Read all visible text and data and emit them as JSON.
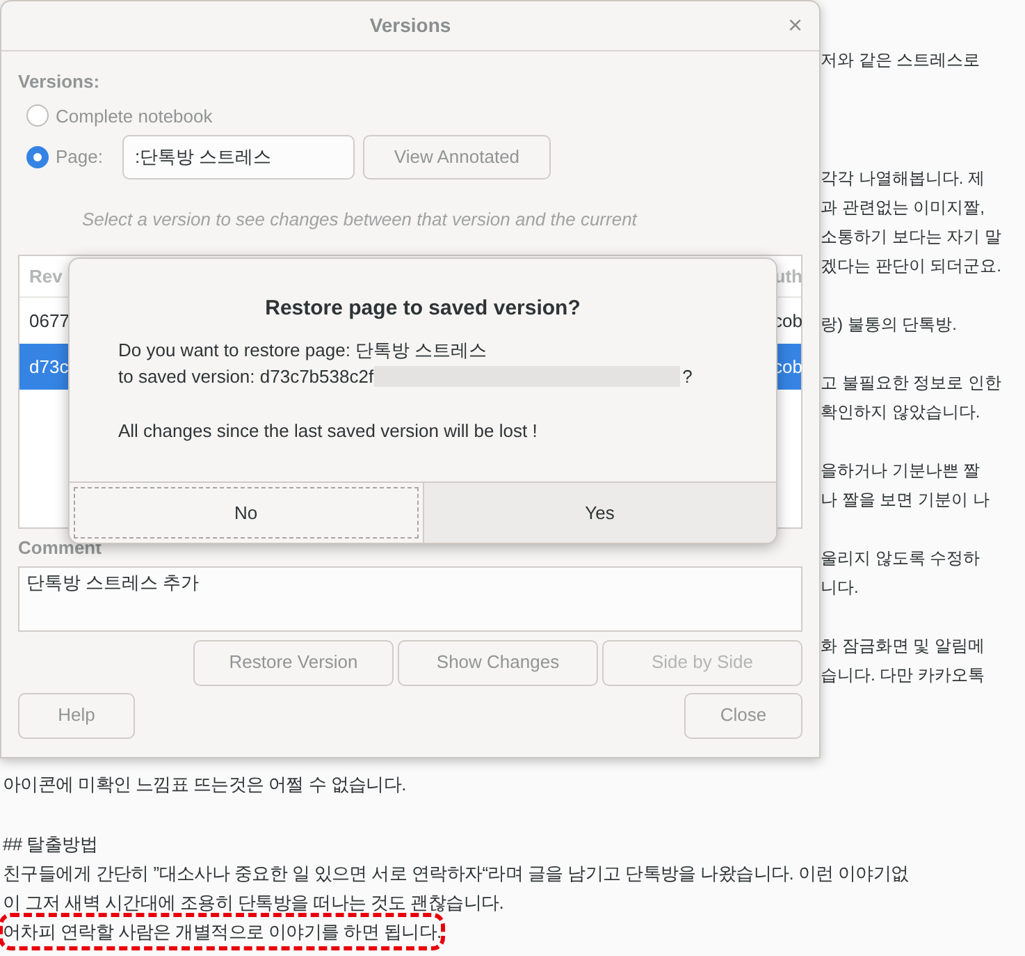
{
  "document": {
    "right_lines": [
      "저와 같은 스트레스로",
      "각각 나열해봅니다. 제",
      "과 관련없는 이미지짤,",
      "소통하기 보다는 자기 말",
      "겠다는 판단이 되더군요.",
      "랑) 불통의 단톡방.",
      "고 불필요한 정보로 인한",
      "확인하지 않았습니다.",
      "을하거나 기분나쁜 짤",
      "나 짤을 보면 기분이 나",
      "울리지 않도록 수정하",
      "니다.",
      "화 잠금화면 및 알림메",
      "습니다. 다만 카카오톡"
    ],
    "bottom_lines": [
      {
        "text": "아이콘에 미확인 느낌표 뜨는것은 어쩔 수 없습니다.",
        "highlighted": false
      },
      {
        "text": "## 탈출방법",
        "highlighted": false
      },
      {
        "text": "친구들에게 간단히 ”대소사나 중요한 일 있으면 서로 연락하자“라며 글을 남기고 단톡방을 나왔습니다. 이런 이야기없",
        "highlighted": false
      },
      {
        "text": "이 그저 새벽 시간대에 조용히 단톡방을 떠나는 것도 괜찮습니다.",
        "highlighted": false
      },
      {
        "text": "어차피 연락할 사람은 개별적으로 이야기를 하면 됩니다.",
        "highlighted": true
      }
    ]
  },
  "window": {
    "title": "Versions",
    "close": "×",
    "versions_label": "Versions:",
    "scope_options": [
      {
        "label": "Complete notebook",
        "selected": false
      },
      {
        "label": "Page:",
        "selected": true
      }
    ],
    "page_field": {
      "value": ":단톡방 스트레스"
    },
    "view_annotated": "View Annotated",
    "hint": [
      "Select a version to see changes between that version and the current"
    ],
    "table": {
      "columns": [
        "Rev",
        "uth"
      ],
      "rows": [
        {
          "rev": "0677",
          "author": "cob",
          "selected": false
        },
        {
          "rev": "d73c",
          "author": "cob",
          "selected": true
        }
      ]
    },
    "comment_label": "Comment",
    "comment": {
      "value": "단톡방 스트레스 추가"
    },
    "actions": [
      {
        "label": "Restore Version",
        "disabled": false
      },
      {
        "label": "Show Changes",
        "disabled": false
      },
      {
        "label": "Side by Side",
        "disabled": true
      }
    ],
    "help": "Help",
    "close_button": "Close"
  },
  "dialog": {
    "title": "Restore page to saved version?",
    "line_1": "Do you want to restore page: 단톡방 스트레스",
    "line_2": "to saved version: d73c7b538c2f",
    "line_2_end": "?",
    "warning": "All changes since the last saved version will be lost !",
    "buttons": [
      {
        "label": "No",
        "focused": true
      },
      {
        "label": "Yes",
        "focused": false
      }
    ]
  }
}
